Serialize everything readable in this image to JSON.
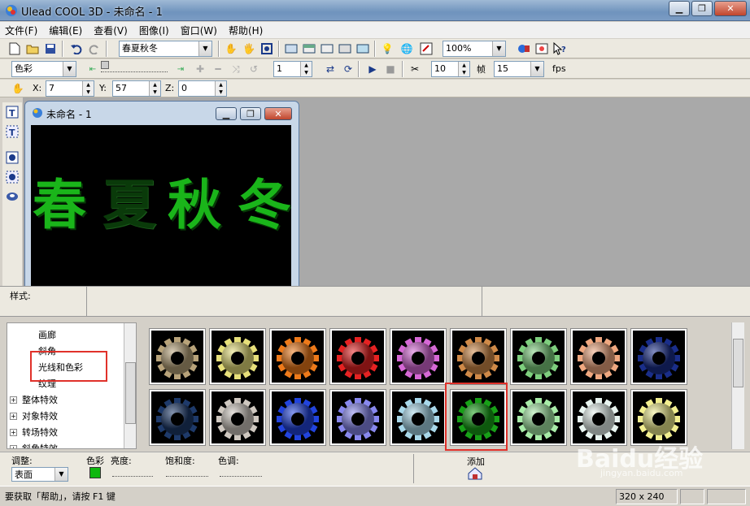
{
  "window": {
    "title": "Ulead COOL 3D - 未命名 - 1"
  },
  "menu": [
    "文件(F)",
    "编辑(E)",
    "查看(V)",
    "图像(I)",
    "窗口(W)",
    "帮助(H)"
  ],
  "toolbar1": {
    "text_object": "春夏秋冬",
    "zoom": "100%"
  },
  "toolbar2": {
    "attribute": "色彩",
    "frame": "1",
    "speed": "10",
    "frames_label": "帧",
    "fps_value": "15",
    "fps_label": "fps"
  },
  "toolbar3": {
    "x_label": "X:",
    "x_value": "7",
    "y_label": "Y:",
    "y_value": "57",
    "z_label": "Z:",
    "z_value": "0"
  },
  "doc": {
    "title": "未命名 - 1",
    "canvas_text": [
      "春",
      "夏",
      "秋",
      "冬"
    ]
  },
  "style_panel": {
    "label": "样式:"
  },
  "tree": {
    "items": [
      {
        "label": "画廊"
      },
      {
        "label": "斜角"
      },
      {
        "label": "光线和色彩"
      },
      {
        "label": "纹理"
      },
      {
        "label": "整体特效"
      },
      {
        "label": "对象特效"
      },
      {
        "label": "转场特效"
      },
      {
        "label": "斜角特效"
      }
    ]
  },
  "thumbnails": {
    "row1": [
      "#b8a37a",
      "#e7e07a",
      "#ee7a1a",
      "#e62222",
      "#d668d6",
      "#d08a48",
      "#7ecf7e",
      "#f0a880",
      "#1a2e8a"
    ],
    "row2": [
      "#1e3a6a",
      "#cfc8c0",
      "#2244dd",
      "#8888ee",
      "#a8d8ea",
      "#18a018",
      "#a8eca8",
      "#e8f4f0",
      "#f2ef90"
    ],
    "selected_row": 2,
    "selected_index": 6
  },
  "controls": {
    "adjust_label": "调整:",
    "adjust_value": "表面",
    "color_label": "色彩",
    "color_value": "#0fb80f",
    "brightness_label": "亮度:",
    "saturation_label": "饱和度:",
    "hue_label": "色调:",
    "add_label": "添加"
  },
  "status": {
    "help_text": "要获取「帮助」，请按 F1 键",
    "size": "320 x 240"
  },
  "watermark": {
    "brand": "Baidu经验",
    "url": "jingyan.baidu.com"
  }
}
